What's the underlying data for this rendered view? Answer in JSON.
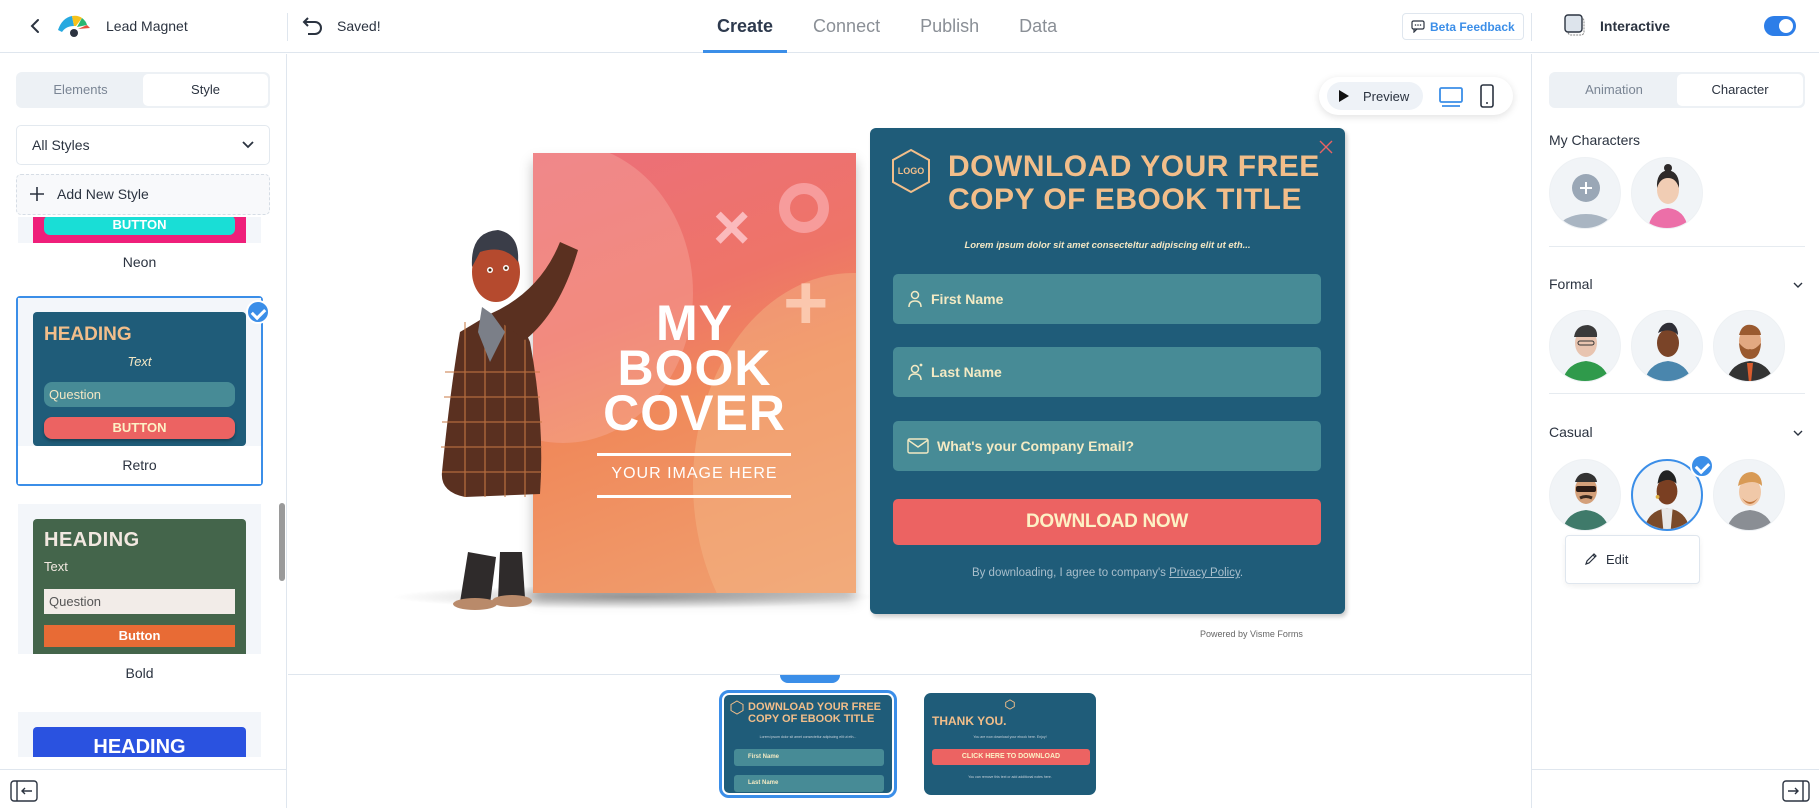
{
  "header": {
    "app_title": "Lead Magnet",
    "save_status": "Saved!",
    "tabs": [
      {
        "label": "Create",
        "active": true
      },
      {
        "label": "Connect",
        "active": false
      },
      {
        "label": "Publish",
        "active": false
      },
      {
        "label": "Data",
        "active": false
      }
    ],
    "beta_feedback_label": "Beta Feedback",
    "interactive_label": "Interactive",
    "interactive_enabled": true,
    "accent_color": "#3b8ee8"
  },
  "left_panel": {
    "tabs": [
      {
        "label": "Elements",
        "active": false
      },
      {
        "label": "Style",
        "active": true
      }
    ],
    "filter_select": "All Styles",
    "add_style_label": "Add New Style",
    "styles": [
      {
        "name": "Neon",
        "button_label": "BUTTON",
        "selected": false
      },
      {
        "name": "Retro",
        "heading": "HEADING",
        "text": "Text",
        "question": "Question",
        "button_label": "BUTTON",
        "selected": true
      },
      {
        "name": "Bold",
        "heading": "HEADING",
        "text": "Text",
        "question": "Question",
        "button_label": "Button",
        "selected": false
      },
      {
        "name": "",
        "heading": "HEADING",
        "selected": false
      }
    ]
  },
  "canvas": {
    "preview_label": "Preview",
    "device_mode": "desktop",
    "book_cover": {
      "title_lines": [
        "MY",
        "BOOK",
        "COVER"
      ],
      "subtitle": "YOUR  IMAGE HERE"
    },
    "form": {
      "logo_text": "LOGO",
      "heading_lines": [
        "DOWNLOAD YOUR FREE",
        "COPY OF EBOOK TITLE"
      ],
      "subheading": "Lorem ipsum dolor sit amet consecteltur adipiscing elit ut eth...",
      "fields": [
        {
          "placeholder": "First Name",
          "icon": "user-icon"
        },
        {
          "placeholder": "Last Name",
          "icon": "user-plus-icon"
        },
        {
          "placeholder": "What's your Company Email?",
          "icon": "envelope-icon"
        }
      ],
      "submit_label": "DOWNLOAD NOW",
      "consent_prefix": "By downloading, I agree to company's ",
      "consent_link": "Privacy Policy",
      "consent_suffix": ".",
      "bg_color": "#1f5c79",
      "heading_color": "#f2be8a",
      "button_color": "#ec6362"
    },
    "powered_by": "Powered by Visme Forms"
  },
  "pages": [
    {
      "heading_lines": [
        "DOWNLOAD YOUR FREE",
        "COPY OF EBOOK TITLE"
      ],
      "field1": "First Name",
      "field2": "Last Name",
      "selected": true
    },
    {
      "heading": "THANK YOU.",
      "button_label": "CLICK HERE TO DOWNLOAD",
      "selected": false
    }
  ],
  "right_panel": {
    "tabs": [
      {
        "label": "Animation",
        "active": false
      },
      {
        "label": "Character",
        "active": true
      }
    ],
    "sections": [
      {
        "title": "My Characters",
        "items": [
          "add-character",
          "character-pink-jacket"
        ]
      },
      {
        "title": "Formal",
        "items": [
          "character-green-sweater",
          "character-blue-shirt",
          "character-bearded-vest"
        ]
      },
      {
        "title": "Casual",
        "items": [
          "character-sunglasses",
          "character-plaid-coat",
          "character-blond-beard"
        ],
        "selected": "character-plaid-coat"
      }
    ],
    "edit_label": "Edit"
  }
}
